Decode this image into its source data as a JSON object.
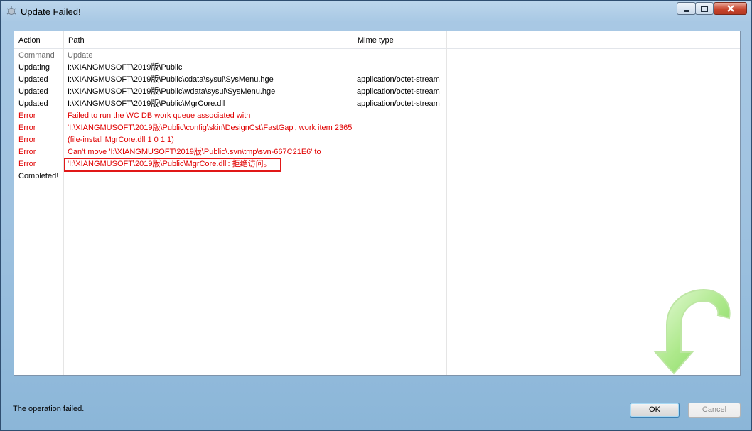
{
  "window": {
    "title": "Update Failed!",
    "app_icon": "tortoisesvn-icon"
  },
  "columns": [
    "Action",
    "Path",
    "Mime type"
  ],
  "rows": [
    {
      "action": "Command",
      "path": "Update",
      "mime": "",
      "style": "grey"
    },
    {
      "action": "Updating",
      "path": "I:\\XIANGMUSOFT\\2019版\\Public",
      "mime": "",
      "style": "normal"
    },
    {
      "action": "Updated",
      "path": "I:\\XIANGMUSOFT\\2019版\\Public\\cdata\\sysui\\SysMenu.hge",
      "mime": "application/octet-stream",
      "style": "normal"
    },
    {
      "action": "Updated",
      "path": "I:\\XIANGMUSOFT\\2019版\\Public\\wdata\\sysui\\SysMenu.hge",
      "mime": "application/octet-stream",
      "style": "normal"
    },
    {
      "action": "Updated",
      "path": "I:\\XIANGMUSOFT\\2019版\\Public\\MgrCore.dll",
      "mime": "application/octet-stream",
      "style": "normal"
    },
    {
      "action": "Error",
      "path": "Failed to run the WC DB work queue associated with",
      "mime": "",
      "style": "err"
    },
    {
      "action": "Error",
      "path": " 'I:\\XIANGMUSOFT\\2019版\\Public\\config\\skin\\DesignCst\\FastGap', work item 2365",
      "mime": "",
      "style": "err"
    },
    {
      "action": "Error",
      "path": " (file-install MgrCore.dll 1 0 1 1)",
      "mime": "",
      "style": "err"
    },
    {
      "action": "Error",
      "path": "Can't move 'I:\\XIANGMUSOFT\\2019版\\Public\\.svn\\tmp\\svn-667C21E6' to",
      "mime": "",
      "style": "err"
    },
    {
      "action": "Error",
      "path": " 'I:\\XIANGMUSOFT\\2019版\\Public\\MgrCore.dll': 拒绝访问。",
      "mime": "",
      "style": "err"
    },
    {
      "action": "Completed!",
      "path": "",
      "mime": "",
      "style": "normal"
    }
  ],
  "status": "The operation failed.",
  "buttons": {
    "ok_prefix": "",
    "ok_underlined": "O",
    "ok_rest": "K",
    "cancel": "Cancel"
  },
  "colors": {
    "error": "#e00000",
    "grey": "#6d6d6d",
    "highlight": "#e11818",
    "arrow_green": "#7ed957"
  },
  "decorations": {
    "update_arrow": "green-update-arrow-icon"
  }
}
